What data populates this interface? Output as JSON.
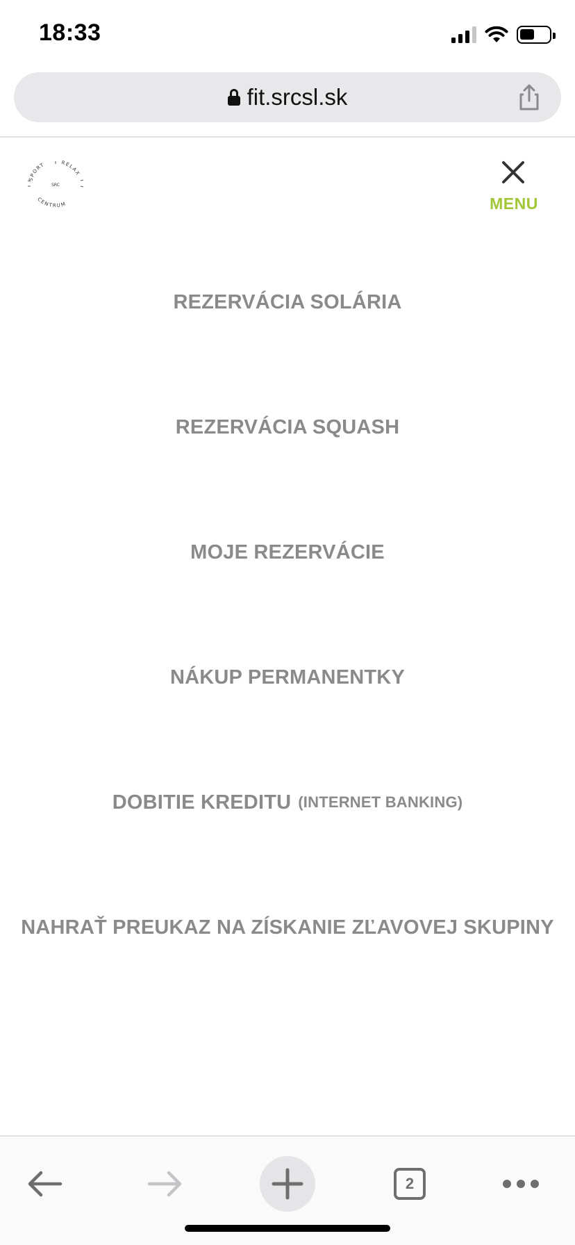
{
  "status_bar": {
    "time": "18:33",
    "icons": [
      "cellular-signal-icon",
      "wifi-icon",
      "battery-icon"
    ]
  },
  "browser": {
    "url": "fit.srcsl.sk",
    "icons": [
      "lock-icon",
      "share-icon"
    ]
  },
  "site_header": {
    "logo": {
      "top_left": "SPORT",
      "top_right": "RELAX",
      "center": "SRC",
      "bottom": "CENTRUM"
    },
    "menu_label": "MENU",
    "close_icon": "close-icon"
  },
  "menu": {
    "items": [
      {
        "label": "REZERVÁCIA SOLÁRIA",
        "suffix": ""
      },
      {
        "label": "REZERVÁCIA SQUASH",
        "suffix": ""
      },
      {
        "label": "MOJE REZERVÁCIE",
        "suffix": ""
      },
      {
        "label": "NÁKUP PERMANENTKY",
        "suffix": ""
      },
      {
        "label": "DOBITIE KREDITU",
        "suffix": "(INTERNET BANKING)"
      },
      {
        "label": "NAHRAŤ PREUKAZ NA ZÍSKANIE ZĽAVOVEJ SKUPINY",
        "suffix": ""
      }
    ]
  },
  "toolbar": {
    "tab_count": "2",
    "icons": [
      "back-arrow-icon",
      "forward-arrow-icon",
      "plus-icon",
      "tabs-icon",
      "more-dots-icon"
    ]
  },
  "colors": {
    "accent": "#a2c637",
    "menu_text": "#8a8a8a",
    "url_bar_bg": "#e8e8ea"
  }
}
